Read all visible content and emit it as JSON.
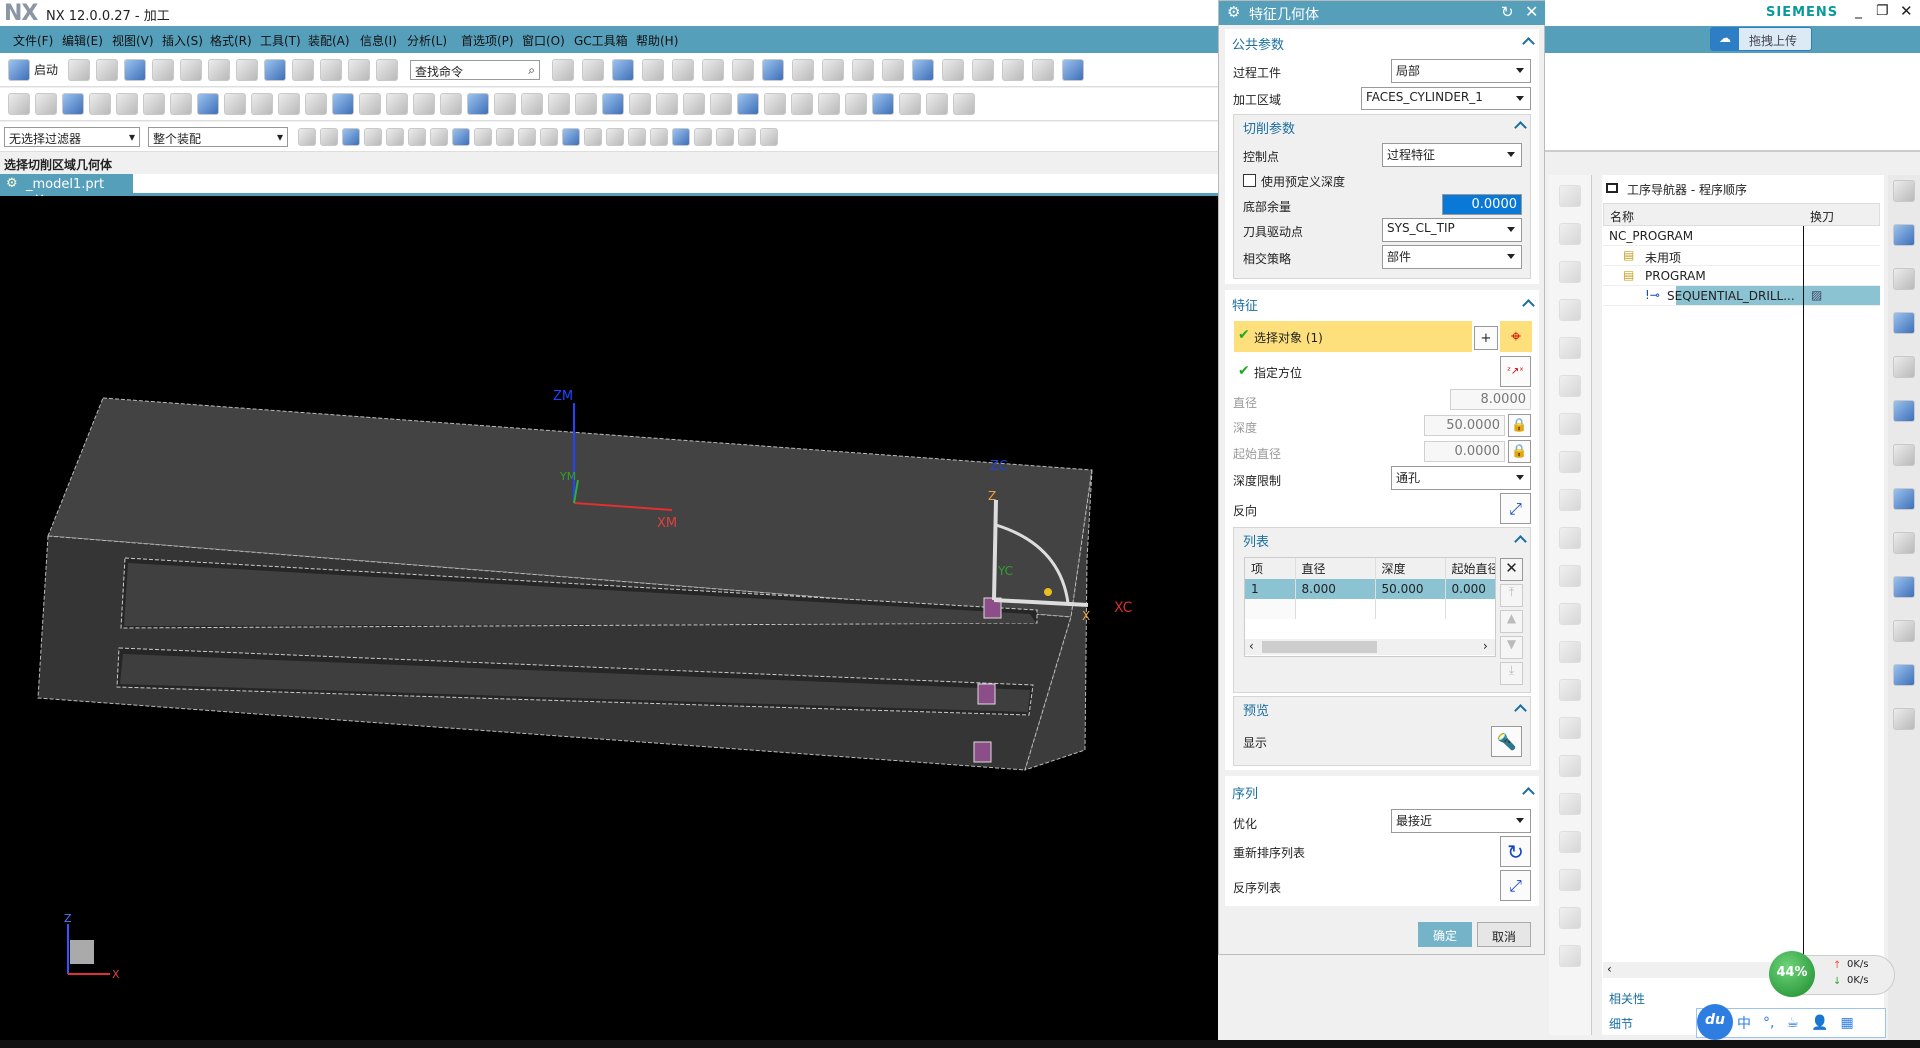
{
  "window": {
    "logo": "NX",
    "title": "NX 12.0.0.27 - 加工",
    "brand": "SIEMENS",
    "upload_button": "拖拽上传"
  },
  "menu": [
    "文件(F)",
    "编辑(E)",
    "视图(V)",
    "插入(S)",
    "格式(R)",
    "工具(T)",
    "装配(A)",
    "信息(I)",
    "分析(L)",
    "首选项(P)",
    "窗口(O)",
    "GC工具箱",
    "帮助(H)"
  ],
  "toolbar": {
    "start_label": "启动",
    "search_placeholder": "查找命令",
    "filter_select": "无选择过滤器",
    "scope_select": "整个装配",
    "row1_icons": [
      "new-icon",
      "open-icon",
      "save-icon",
      "print-icon",
      "cut-icon",
      "copy-icon",
      "paste-icon",
      "delete-icon",
      "undo-icon",
      "repeat-icon",
      "window-icon",
      "info-icon"
    ],
    "row1b_icons": [
      "fit-icon",
      "shade-icon",
      "cube-icon",
      "folder-icon",
      "layer-icon",
      "blank-icon",
      "move-icon",
      "transform-icon",
      "list-icon",
      "csys-icon",
      "assembly-icon",
      "feature-icon",
      "operation-icon",
      "point-icon",
      "add-icon",
      "lift-icon",
      "cylinder-icon",
      "view-icon"
    ],
    "row2_icons": [
      "line-icon",
      "line2-icon",
      "arc-icon",
      "helix-icon",
      "spiral-icon",
      "point-set-icon",
      "dots-icon",
      "text-icon",
      "profile-icon",
      "offset-icon",
      "curve-icon",
      "bridge-icon",
      "mesh-icon",
      "split-icon",
      "extract-icon",
      "sketch-icon",
      "trim-icon",
      "extend-icon",
      "fillet-icon",
      "corner-icon",
      "chamfer-icon",
      "circle-icon",
      "circle2-icon",
      "circle3-icon",
      "circle4-icon",
      "surface-icon",
      "block-icon",
      "solid-icon",
      "color-tree-icon",
      "tool-color-icon",
      "ruler-icon",
      "tool-holder-icon",
      "cylinder-tool-icon",
      "mill-tool-icon",
      "vector-icon",
      "plus-icon"
    ],
    "row3_icons": [
      "snap-icon",
      "point-snap-icon",
      "red-box-icon",
      "midpoint-icon",
      "tangent-icon",
      "hex-icon",
      "center-icon",
      "rect-select-icon",
      "cube-view-icon",
      "cube-blue-icon",
      "snap-active-icon",
      "end-icon",
      "mid-icon",
      "curve-snap-icon",
      "intersect-icon",
      "circle-snap-icon",
      "quadrant-icon",
      "cross-icon",
      "point-on-icon",
      "face-icon",
      "solid-snap-icon",
      "grid-icon"
    ]
  },
  "status_line": "选择切削区域几何体",
  "file_tab": "_model1.prt",
  "viewport": {
    "labels": {
      "zm": "ZM",
      "xm": "XM",
      "ym": "YM",
      "zc": "ZC",
      "xc": "XC",
      "yc": "YC",
      "z": "Z",
      "x": "X",
      "triad_z": "Z",
      "triad_x": "X"
    }
  },
  "dialog": {
    "title": "特征几何体",
    "common": {
      "header": "公共参数",
      "process_workpiece_label": "过程工件",
      "process_workpiece": "局部",
      "machining_area_label": "加工区域",
      "machining_area": "FACES_CYLINDER_1"
    },
    "cut_params": {
      "header": "切削参数",
      "control_point_label": "控制点",
      "control_point": "过程特征",
      "use_predefined_depth": "使用预定义深度",
      "use_predefined_depth_checked": false,
      "bottom_stock_label": "底部余量",
      "bottom_stock": "0.0000",
      "tool_drive_point_label": "刀具驱动点",
      "tool_drive_point": "SYS_CL_TIP",
      "intersect_strategy_label": "相交策略",
      "intersect_strategy": "部件"
    },
    "feature": {
      "header": "特征",
      "select_object": "选择对象 (1)",
      "specify_orientation": "指定方位",
      "diameter_label": "直径",
      "diameter": "8.0000",
      "depth_label": "深度",
      "depth": "50.0000",
      "start_diameter_label": "起始直径",
      "start_diameter": "0.0000",
      "depth_limit_label": "深度限制",
      "depth_limit": "通孔",
      "reverse_label": "反向"
    },
    "list": {
      "header": "列表",
      "columns": [
        "项",
        "直径",
        "深度",
        "起始直径"
      ],
      "rows": [
        [
          "1",
          "8.000",
          "50.000",
          "0.000"
        ]
      ]
    },
    "preview": {
      "header": "预览",
      "show_label": "显示"
    },
    "sequence": {
      "header": "序列",
      "optimize_label": "优化",
      "optimize": "最接近",
      "resequence_label": "重新排序列表",
      "reverse_list_label": "反序列表"
    },
    "ok": "确定",
    "cancel": "取消"
  },
  "navigator": {
    "title": "工序导航器 - 程序顺序",
    "columns": [
      "名称",
      "换刀"
    ],
    "rows": [
      {
        "name": "NC_PROGRAM",
        "indent": 0
      },
      {
        "name": "未用项",
        "indent": 1
      },
      {
        "name": "PROGRAM",
        "indent": 1
      },
      {
        "name": "SEQUENTIAL_DRILL...",
        "indent": 2,
        "selected": true
      }
    ],
    "relevance": "相关性",
    "details": "细节"
  },
  "overlay": {
    "cpu": "44%",
    "up_speed": "0K/s",
    "down_speed": "0K/s",
    "ime_logo": "du",
    "ime_items": [
      "中",
      "°,",
      "☕",
      "👤",
      "▦"
    ]
  },
  "colors": {
    "accent": "#569fba",
    "selected_row": "#8cc3d3",
    "highlight": "#fde07c",
    "ok_button": "#75b3c9"
  }
}
